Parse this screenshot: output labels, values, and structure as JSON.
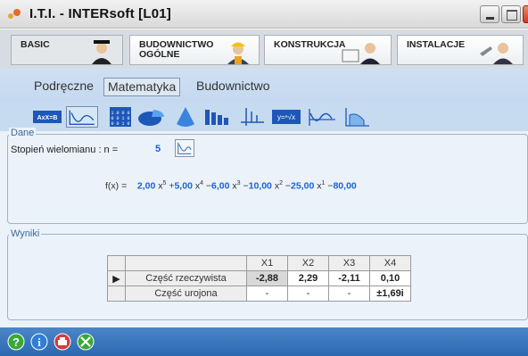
{
  "window": {
    "title": "I.T.I. - INTERsoft [L01]",
    "icon": "app-icon",
    "buttons": [
      "minimize",
      "maximize",
      "close"
    ]
  },
  "modules": [
    {
      "label": "BASIC",
      "icon": "graduate-icon"
    },
    {
      "label": "BUDOWNICTWO\nOGÓLNE",
      "icon": "builder-icon"
    },
    {
      "label": "KONSTRUKCJA",
      "icon": "engineer-icon"
    },
    {
      "label": "INSTALACJE",
      "icon": "installer-icon"
    }
  ],
  "subtabs": [
    "Podręczne",
    "Matematyka",
    "Budownictwo"
  ],
  "active_subtab": "Matematyka",
  "tools": [
    {
      "icon": "axb-equation-icon",
      "text": "AxX=B"
    },
    {
      "icon": "polynomial-curve-icon",
      "selected": true
    },
    {
      "icon": "matrix-icon",
      "text": "1 0 0 0"
    },
    {
      "icon": "pie-icon"
    },
    {
      "icon": "drop-icon"
    },
    {
      "icon": "bar-chart-icon"
    },
    {
      "icon": "axes-chart-icon"
    },
    {
      "icon": "y-root-icon",
      "text": "y=ⁿ√x"
    },
    {
      "icon": "wave-function-icon"
    },
    {
      "icon": "integral-area-icon"
    }
  ],
  "dane": {
    "legend": "Dane",
    "degree_label": "Stopień wielomianu : n =",
    "degree_value": "5",
    "formula": {
      "lhs": "f(x) =",
      "terms": [
        {
          "coef": "2,00",
          "power": "5",
          "sign": ""
        },
        {
          "coef": "5,00",
          "power": "4",
          "sign": "+"
        },
        {
          "coef": "6,00",
          "power": "3",
          "sign": "−"
        },
        {
          "coef": "10,00",
          "power": "2",
          "sign": "−"
        },
        {
          "coef": "25,00",
          "power": "1",
          "sign": "−"
        },
        {
          "coef": "80,00",
          "power": "",
          "sign": "−"
        }
      ]
    }
  },
  "wyniki": {
    "legend": "Wyniki",
    "columns": [
      "X1",
      "X2",
      "X3",
      "X4"
    ],
    "rows": [
      {
        "label": "Część rzeczywista",
        "values": [
          "-2,88",
          "2,29",
          "-2,11",
          "0,10"
        ]
      },
      {
        "label": "Część urojona",
        "values": [
          "-",
          "-",
          "-",
          "±1,69i"
        ]
      }
    ]
  },
  "status_buttons": [
    {
      "icon": "help-icon",
      "color": "#3aa835"
    },
    {
      "icon": "info-icon",
      "color": "#2f7fd8"
    },
    {
      "icon": "print-icon",
      "color": "#d73a3a"
    },
    {
      "icon": "tools-icon",
      "color": "#3aa835"
    }
  ]
}
